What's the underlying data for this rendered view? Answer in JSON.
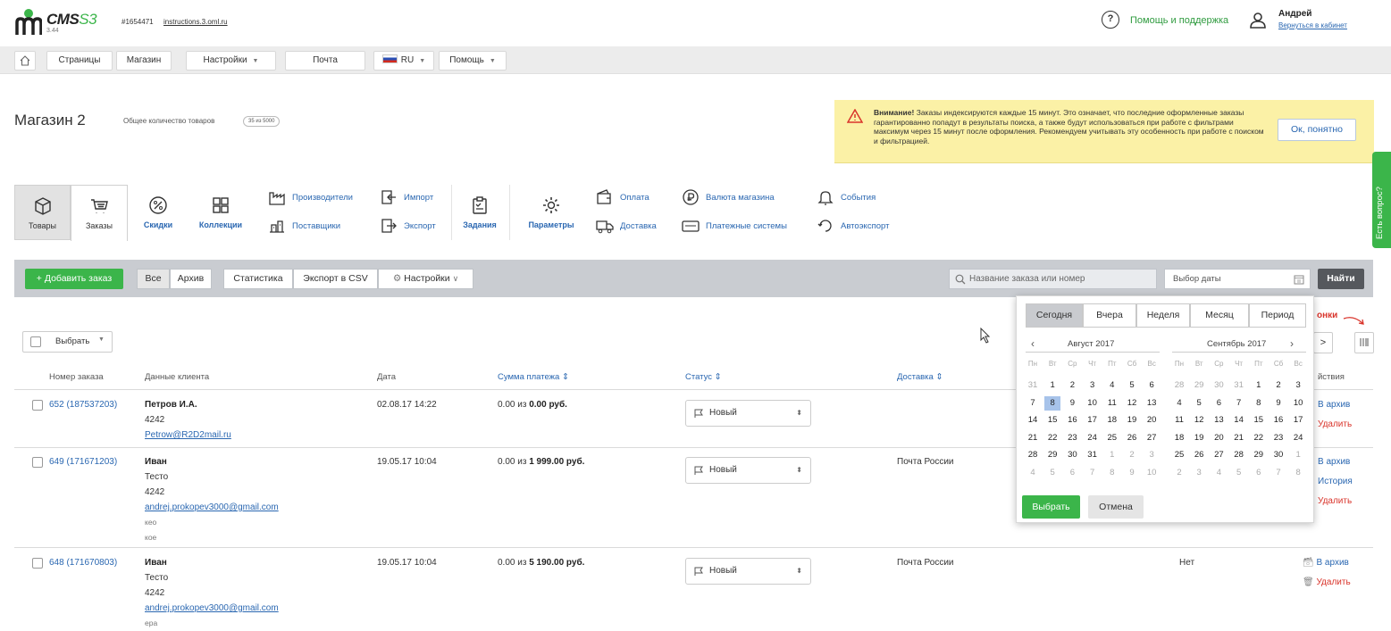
{
  "header": {
    "logo_text": "CMS",
    "logo_suffix": "S3",
    "logo_version": "3.44",
    "site_id": "#1654471",
    "site_link": "instructions.3.oml.ru",
    "help_label": "Помощь и поддержка",
    "user_name": "Андрей",
    "user_back_link": "Вернуться в кабинет",
    "brand_color": "#3bb54a"
  },
  "nav": {
    "home_icon": "home-icon",
    "items": [
      {
        "label": "Страницы"
      },
      {
        "label": "Магазин"
      },
      {
        "label": "Настройки"
      },
      {
        "label": "Почта"
      },
      {
        "label": "RU"
      },
      {
        "label": "Помощь"
      }
    ]
  },
  "page": {
    "title": "Магазин 2",
    "goods_count_label": "Общее количество товаров",
    "goods_badge": "35 из 5000"
  },
  "warning": {
    "bold": "Внимание!",
    "text": " Заказы индексируются каждые 15 минут. Это означает, что последние оформленные заказы гарантированно попадут в результаты поиска, а также будут использоваться при работе с фильтрами максимум через 15 минут после оформления. Рекомендуем учитывать эту особенность при работе с поиском и фильтрацией.",
    "button": "Ок, понятно"
  },
  "modules": {
    "tab_goods": "Товары",
    "tab_orders": "Заказы",
    "discounts": "Скидки",
    "collections": "Коллекции",
    "manufacturers": "Производители",
    "suppliers": "Поставщики",
    "import": "Импорт",
    "export": "Экспорт",
    "tasks": "Задания",
    "params": "Параметры",
    "payment": "Оплата",
    "delivery": "Доставка",
    "currency": "Валюта магазина",
    "payment_systems": "Платежные системы",
    "events": "События",
    "autoexport": "Автоэкспорт"
  },
  "side_tab": "Есть вопрос?",
  "toolbar": {
    "add_order": "+ Добавить заказ",
    "all": "Все",
    "archive": "Архив",
    "stats": "Статистика",
    "export_csv": "Экспорт в CSV",
    "settings": "Настройки",
    "search_placeholder": "Название заказа или номер",
    "date_placeholder": "Выбор даты",
    "find": "Найти"
  },
  "list": {
    "select_label": "Выбрать",
    "columns_label": "онки",
    "headers": {
      "order": "Номер заказа",
      "client": "Данные клиента",
      "date": "Дата",
      "sum": "Сумма платежа",
      "status": "Статус",
      "delivery": "Доставка",
      "actions": "йствия"
    },
    "rows": [
      {
        "order": "652 (187537203)",
        "client_name": "Петров И.А.",
        "client_line2": "4242",
        "client_email": "Petrow@R2D2mail.ru",
        "date": "02.08.17 14:22",
        "sum_prefix": "0.00 из ",
        "sum_total": "0.00 руб.",
        "status": "Новый",
        "delivery": "",
        "actions": [
          "В архив",
          "Удалить"
        ]
      },
      {
        "order": "649 (171671203)",
        "client_name": "Иван",
        "client_line2": "Тесто",
        "client_line3": "4242",
        "client_email": "andrej.prokopev3000@gmail.com",
        "client_note1": "кео",
        "client_note2": "кое",
        "date": "19.05.17 10:04",
        "sum_prefix": "0.00 из ",
        "sum_total": "1 999.00 руб.",
        "status": "Новый",
        "delivery": "Почта России",
        "actions": [
          "В архив",
          "История",
          "Удалить"
        ]
      },
      {
        "order": "648 (171670803)",
        "client_name": "Иван",
        "client_line2": "Тесто",
        "client_line3": "4242",
        "client_email": "andrej.prokopev3000@gmail.com",
        "client_note1": "ера",
        "date": "19.05.17 10:04",
        "sum_prefix": "0.00 из ",
        "sum_total": "5 190.00 руб.",
        "status": "Новый",
        "delivery": "Почта России",
        "paid": "Нет",
        "actions": [
          "В архив",
          "Удалить"
        ]
      }
    ]
  },
  "calendar": {
    "tabs": [
      "Сегодня",
      "Вчера",
      "Неделя",
      "Месяц",
      "Период"
    ],
    "active_tab": "Сегодня",
    "left_title": "Август 2017",
    "right_title": "Сентябрь 2017",
    "weekdays": [
      "Пн",
      "Вт",
      "Ср",
      "Чт",
      "Пт",
      "Сб",
      "Вс"
    ],
    "left_days": [
      [
        "31",
        "1",
        "2",
        "3",
        "4",
        "5",
        "6"
      ],
      [
        "7",
        "8",
        "9",
        "10",
        "11",
        "12",
        "13"
      ],
      [
        "14",
        "15",
        "16",
        "17",
        "18",
        "19",
        "20"
      ],
      [
        "21",
        "22",
        "23",
        "24",
        "25",
        "26",
        "27"
      ],
      [
        "28",
        "29",
        "30",
        "31",
        "1",
        "2",
        "3"
      ],
      [
        "4",
        "5",
        "6",
        "7",
        "8",
        "9",
        "10"
      ]
    ],
    "right_days": [
      [
        "28",
        "29",
        "30",
        "31",
        "1",
        "2",
        "3"
      ],
      [
        "4",
        "5",
        "6",
        "7",
        "8",
        "9",
        "10"
      ],
      [
        "11",
        "12",
        "13",
        "14",
        "15",
        "16",
        "17"
      ],
      [
        "18",
        "19",
        "20",
        "21",
        "22",
        "23",
        "24"
      ],
      [
        "25",
        "26",
        "27",
        "28",
        "29",
        "30",
        "1"
      ],
      [
        "2",
        "3",
        "4",
        "5",
        "6",
        "7",
        "8"
      ]
    ],
    "selected_day": "8",
    "ok": "Выбрать",
    "cancel": "Отмена"
  }
}
